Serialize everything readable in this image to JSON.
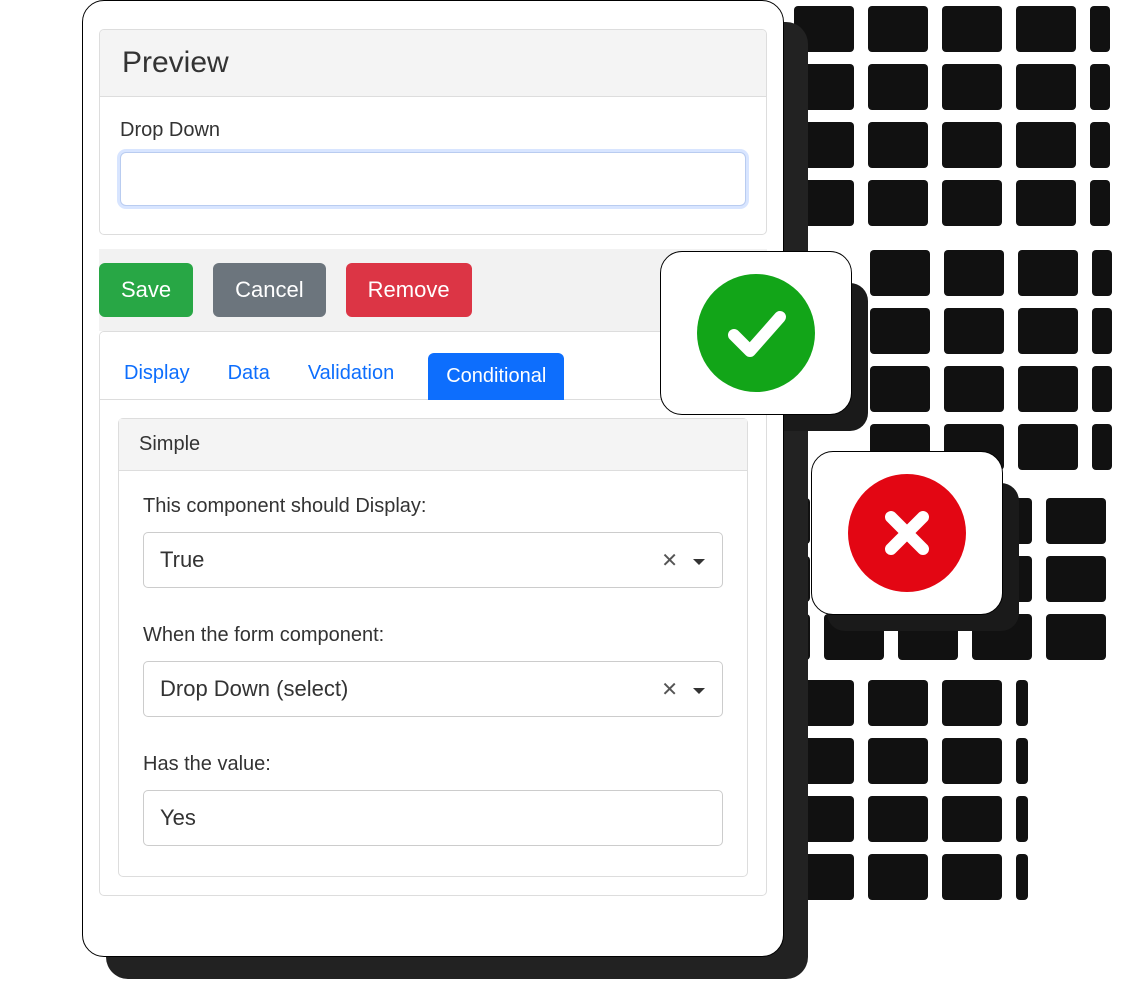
{
  "preview": {
    "title": "Preview",
    "field_label": "Drop Down"
  },
  "buttons": {
    "save": "Save",
    "cancel": "Cancel",
    "remove": "Remove"
  },
  "tabs": {
    "display": "Display",
    "data": "Data",
    "validation": "Validation",
    "conditional": "Conditional"
  },
  "simple": {
    "header": "Simple",
    "display_label": "This component should Display:",
    "display_value": "True",
    "when_label": "When the form component:",
    "when_value": "Drop Down (select)",
    "value_label": "Has the value:",
    "value_value": "Yes"
  }
}
